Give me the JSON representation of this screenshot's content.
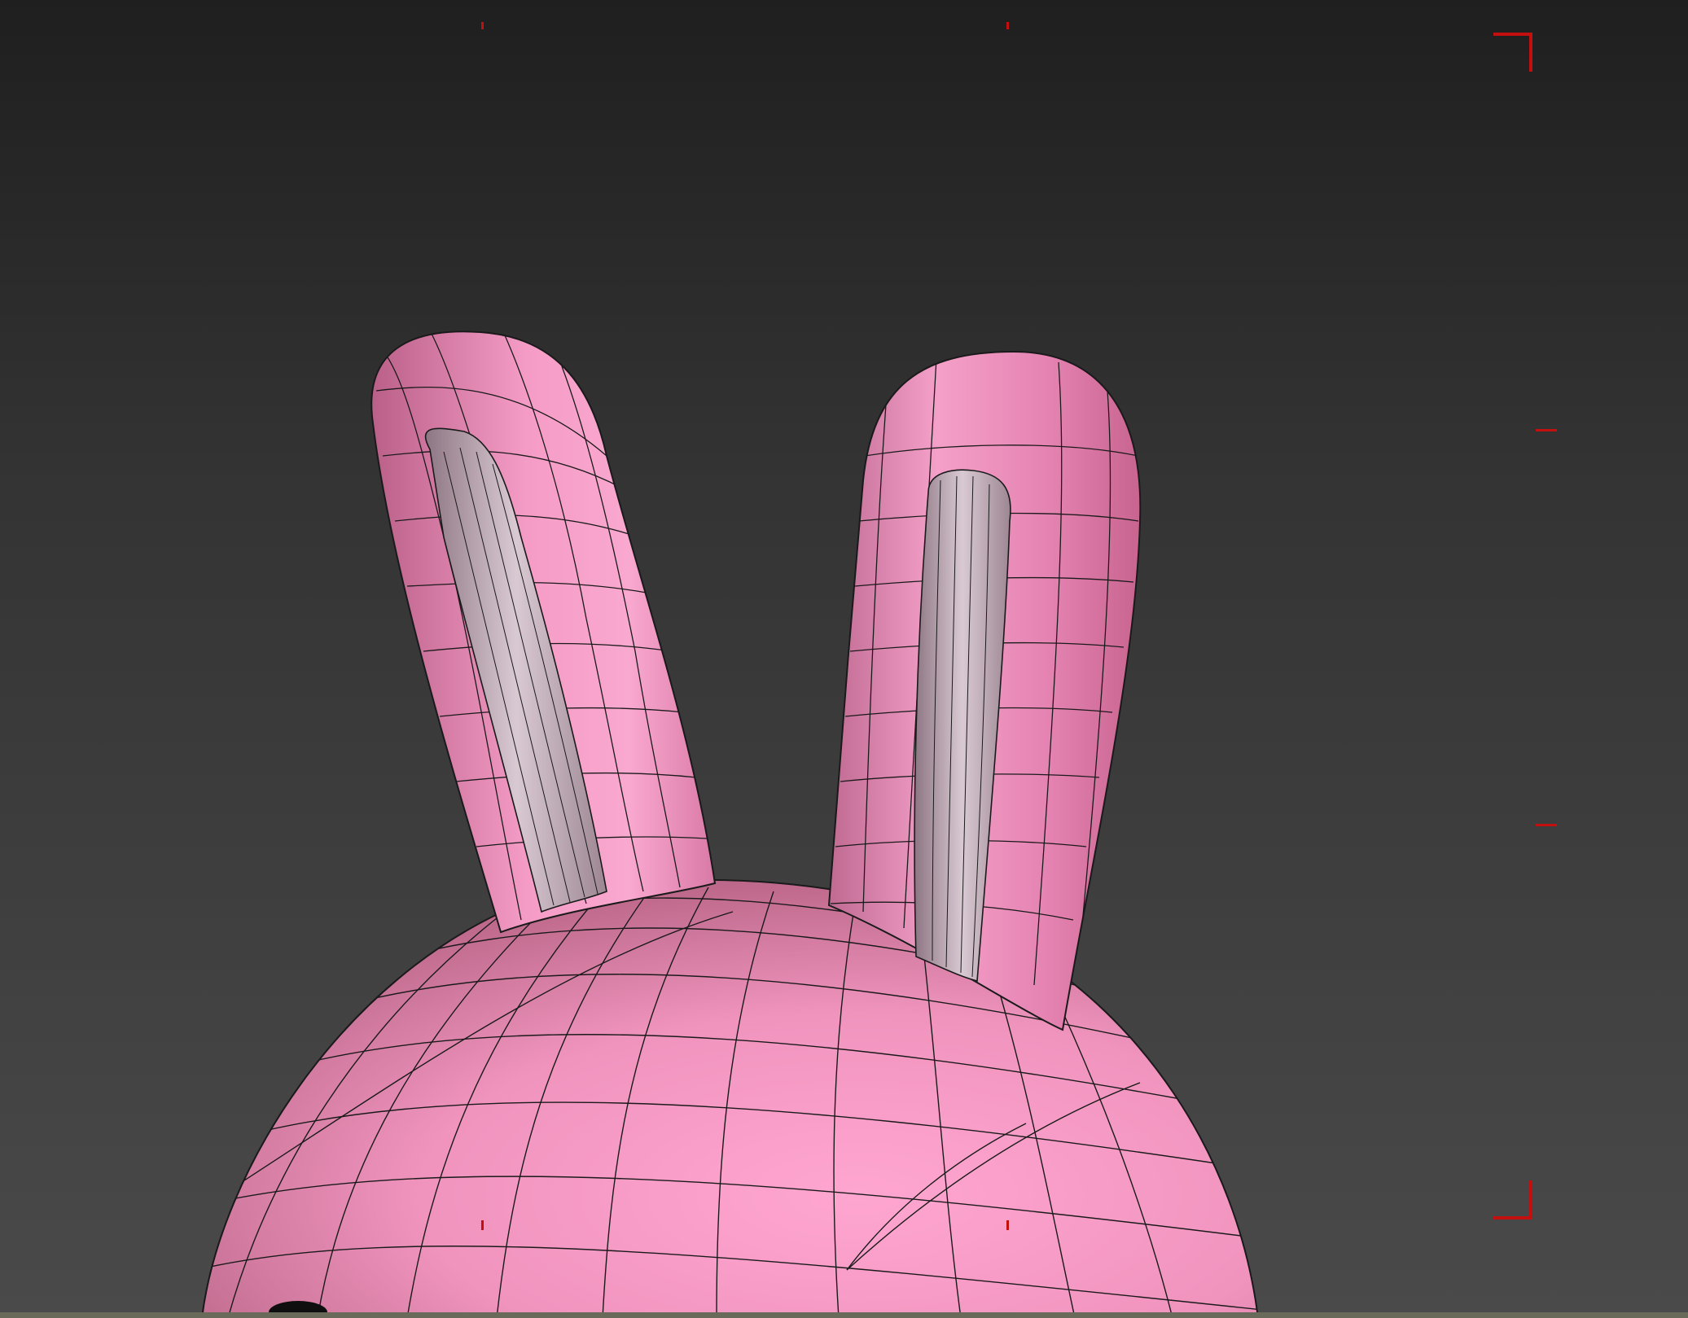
{
  "viewport": {
    "background_top": "#1f1f1f",
    "background_bottom": "#4a4a4a",
    "model": {
      "subject": "rabbit-head",
      "shading": "smooth-with-wireframe-edges",
      "body_color": "#f39ac4",
      "body_shadow_color": "#c4608e",
      "inner_ear_color": "#c9b5c0",
      "wire_color": "#111111"
    },
    "safe_frame_color": "#c40f0f"
  }
}
